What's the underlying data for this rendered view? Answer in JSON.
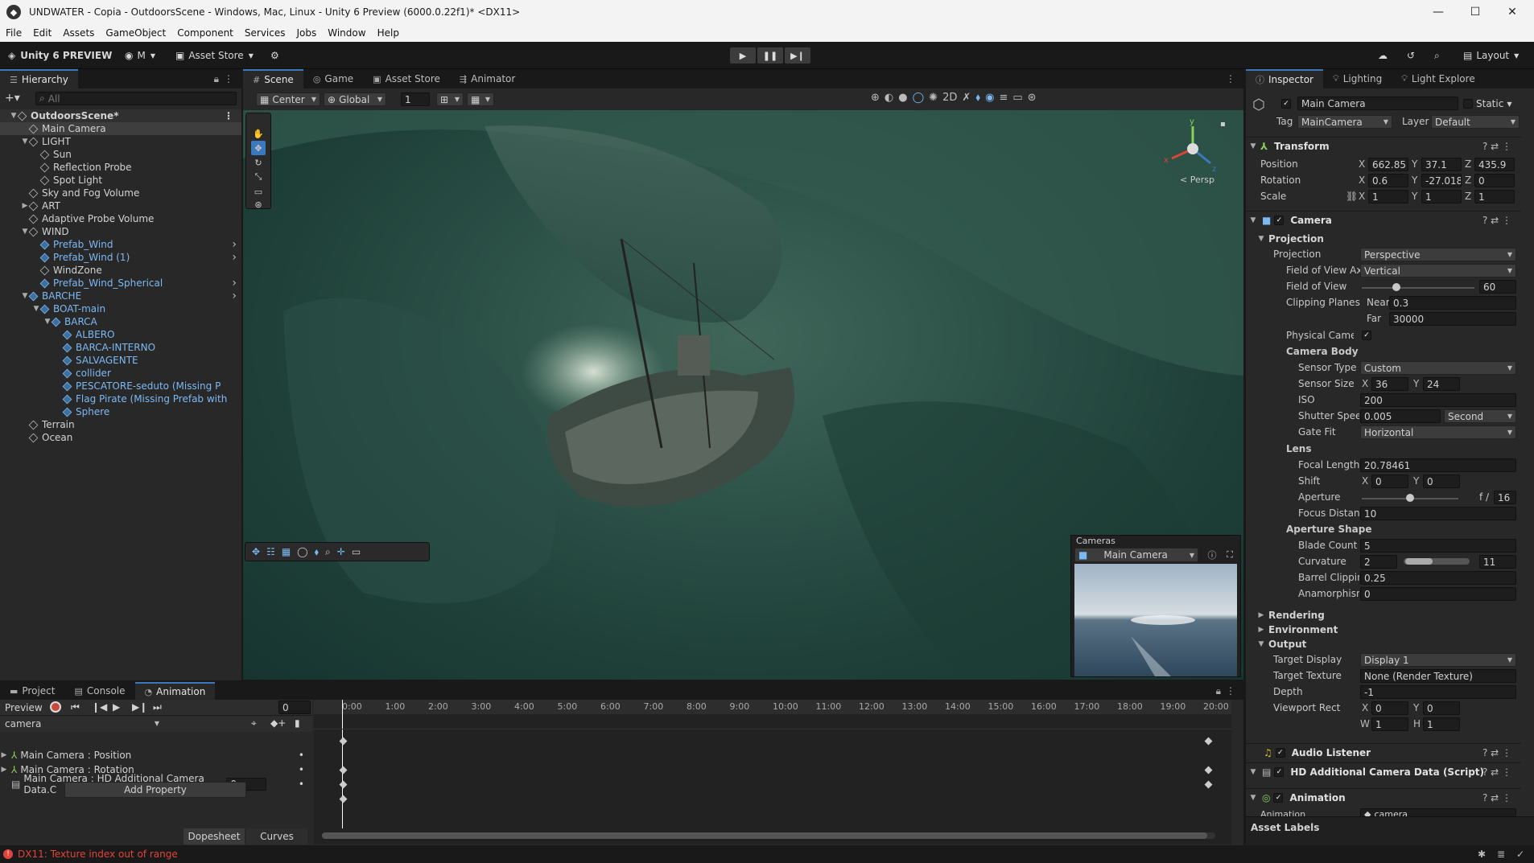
{
  "window": {
    "title": "UNDWATER - Copia - OutdoorsScene - Windows, Mac, Linux - Unity 6 Preview (6000.0.22f1)* <DX11>",
    "min": "—",
    "max": "☐",
    "close": "✕"
  },
  "menu": [
    "File",
    "Edit",
    "Assets",
    "GameObject",
    "Component",
    "Services",
    "Jobs",
    "Window",
    "Help"
  ],
  "toolbar": {
    "brand": "Unity 6 PREVIEW",
    "account": "M",
    "asset_store": "Asset Store",
    "layout": "Layout"
  },
  "hierarchy": {
    "tab": "Hierarchy",
    "search_placeholder": "All",
    "items": [
      {
        "label": "OutdoorsScene*",
        "depth": 0,
        "expanded": true,
        "scene": true
      },
      {
        "label": "Main Camera",
        "depth": 1,
        "selected": true
      },
      {
        "label": "LIGHT",
        "depth": 1,
        "expanded": true
      },
      {
        "label": "Sun",
        "depth": 2
      },
      {
        "label": "Reflection Probe",
        "depth": 2
      },
      {
        "label": "Spot Light",
        "depth": 2
      },
      {
        "label": "Sky and Fog Volume",
        "depth": 1
      },
      {
        "label": "ART",
        "depth": 1,
        "collapsed": true
      },
      {
        "label": "Adaptive Probe Volume",
        "depth": 1
      },
      {
        "label": "WIND",
        "depth": 1,
        "expanded": true
      },
      {
        "label": "Prefab_Wind",
        "depth": 2,
        "prefab": true,
        "arrow": true
      },
      {
        "label": "Prefab_Wind (1)",
        "depth": 2,
        "prefab": true,
        "arrow": true
      },
      {
        "label": "WindZone",
        "depth": 2
      },
      {
        "label": "Prefab_Wind_Spherical",
        "depth": 2,
        "prefab": true,
        "arrow": true
      },
      {
        "label": "BARCHE",
        "depth": 1,
        "expanded": true,
        "prefab": true,
        "arrow": true
      },
      {
        "label": "BOAT-main",
        "depth": 2,
        "expanded": true,
        "prefab": true
      },
      {
        "label": "BARCA",
        "depth": 3,
        "expanded": true,
        "prefab": true
      },
      {
        "label": "ALBERO",
        "depth": 4,
        "prefab": true
      },
      {
        "label": "BARCA-INTERNO",
        "depth": 4,
        "prefab": true
      },
      {
        "label": "SALVAGENTE",
        "depth": 4,
        "prefab": true
      },
      {
        "label": "collider",
        "depth": 4,
        "prefab": true
      },
      {
        "label": "PESCATORE-seduto (Missing P",
        "depth": 4,
        "prefab": true
      },
      {
        "label": "Flag Pirate (Missing Prefab with",
        "depth": 4,
        "prefab": true
      },
      {
        "label": "Sphere",
        "depth": 4,
        "prefab": true
      },
      {
        "label": "Terrain",
        "depth": 1
      },
      {
        "label": "Ocean",
        "depth": 1
      }
    ]
  },
  "scene": {
    "tabs": [
      "Scene",
      "Game",
      "Asset Store",
      "Animator"
    ],
    "pivot": "Center",
    "space": "Global",
    "grid_value": "1",
    "persp_label": "< Persp",
    "gizmo_axes": [
      "y",
      "x",
      "z"
    ],
    "cameras_overlay": {
      "title": "Cameras",
      "camera": "Main Camera"
    }
  },
  "bottom": {
    "tabs": [
      "Project",
      "Console",
      "Animation"
    ],
    "preview": "Preview",
    "frame": "0",
    "clip": "camera",
    "ruler": [
      "0:00",
      "1:00",
      "2:00",
      "3:00",
      "4:00",
      "5:00",
      "6:00",
      "7:00",
      "8:00",
      "9:00",
      "10:00",
      "11:00",
      "12:00",
      "13:00",
      "14:00",
      "15:00",
      "16:00",
      "17:00",
      "18:00",
      "19:00",
      "20:00"
    ],
    "properties": [
      {
        "label": "Main Camera : Position",
        "value": ""
      },
      {
        "label": "Main Camera : Rotation",
        "value": ""
      },
      {
        "label": "Main Camera : HD Additional Camera Data.C",
        "value": "0"
      }
    ],
    "add_property": "Add Property",
    "dopesheet": "Dopesheet",
    "curves": "Curves"
  },
  "inspector": {
    "tabs": [
      "Inspector",
      "Lighting",
      "Light Explore"
    ],
    "object_name": "Main Camera",
    "static": "Static",
    "tag_label": "Tag",
    "tag": "MainCamera",
    "layer_label": "Layer",
    "layer": "Default",
    "transform": {
      "title": "Transform",
      "position_label": "Position",
      "rotation_label": "Rotation",
      "scale_label": "Scale",
      "position": [
        "662.85",
        "37.1",
        "435.9"
      ],
      "rotation": [
        "0.6",
        "-27.018",
        "0"
      ],
      "scale": [
        "1",
        "1",
        "1"
      ]
    },
    "camera": {
      "title": "Camera",
      "projection_head": "Projection",
      "projection_label": "Projection",
      "projection": "Perspective",
      "fov_axis_label": "Field of View Ax",
      "fov_axis": "Vertical",
      "fov_label": "Field of View",
      "fov": "60",
      "fov_fraction": 0.31,
      "clip_label": "Clipping Planes",
      "near_label": "Near",
      "near": "0.3",
      "far_label": "Far",
      "far": "30000",
      "physical_label": "Physical Camera",
      "body_head": "Camera Body",
      "sensor_type_label": "Sensor Type",
      "sensor_type": "Custom",
      "sensor_size_label": "Sensor Size",
      "sensor_x": "36",
      "sensor_y": "24",
      "iso_label": "ISO",
      "iso": "200",
      "shutter_label": "Shutter Speed",
      "shutter": "0.005",
      "shutter_unit": "Second",
      "gate_label": "Gate Fit",
      "gate": "Horizontal",
      "lens_head": "Lens",
      "focal_label": "Focal Length",
      "focal": "20.78461",
      "shift_label": "Shift",
      "shift_x": "0",
      "shift_y": "0",
      "aperture_label": "Aperture",
      "aperture_prefix": "f /",
      "aperture": "16",
      "aperture_fraction": 0.5,
      "focus_label": "Focus Distance",
      "focus": "10",
      "shape_head": "Aperture Shape",
      "blade_label": "Blade Count",
      "blade": "5",
      "curv_label": "Curvature",
      "curv_min": "2",
      "curv_max": "11",
      "barrel_label": "Barrel Clipping",
      "barrel": "0.25",
      "anamorph_label": "Anamorphism",
      "anamorph": "0",
      "rendering": "Rendering",
      "environment": "Environment",
      "output": "Output",
      "target_display_label": "Target Display",
      "target_display": "Display 1",
      "target_texture_label": "Target Texture",
      "target_texture": "None (Render Texture)",
      "depth_label": "Depth",
      "depth": "-1",
      "viewport_label": "Viewport Rect",
      "vx": "0",
      "vy": "0",
      "vw": "1",
      "vh": "1"
    },
    "audio_listener": "Audio Listener",
    "hd_data": "HD Additional Camera Data (Script)",
    "animation": "Animation",
    "animation_field_label": "Animation",
    "animation_field": "camera",
    "asset_labels": "Asset Labels"
  },
  "status": {
    "error": "DX11: Texture index out of range",
    "error_color": "#e0443a"
  },
  "colors": {
    "accent": "#3a79bb",
    "prefab": "#7cb9f3",
    "bg": "#282828"
  }
}
